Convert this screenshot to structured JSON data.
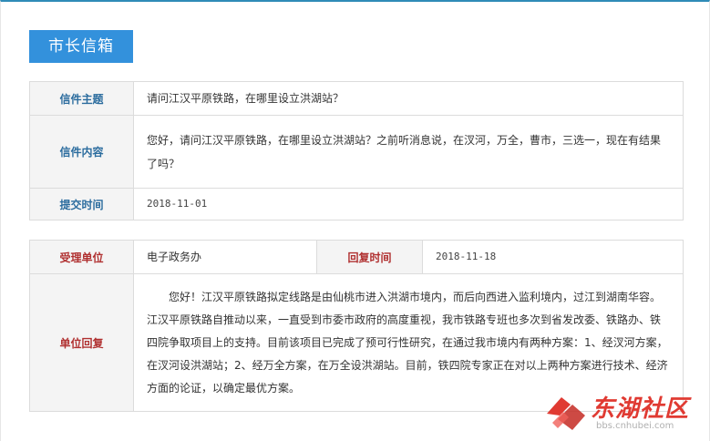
{
  "page": {
    "title_tab": "市长信箱"
  },
  "letter": {
    "subject_label": "信件主题",
    "subject_value": "请问江汉平原铁路，在哪里设立洪湖站？",
    "content_label": "信件内容",
    "content_value": "您好，请问江汉平原铁路，在哪里设立洪湖站？之前听消息说，在汊河，万全，曹市，三选一，现在有结果了吗？",
    "submit_time_label": "提交时间",
    "submit_time_value": "2018-11-01"
  },
  "reply": {
    "dept_label": "受理单位",
    "dept_value": "电子政务办",
    "reply_time_label": "回复时间",
    "reply_time_value": "2018-11-18",
    "answer_label": "单位回复",
    "answer_value": "您好！江汉平原铁路拟定线路是由仙桃市进入洪湖市境内，而后向西进入监利境内，过江到湖南华容。江汉平原铁路自推动以来，一直受到市委市政府的高度重视，我市铁路专班也多次到省发改委、铁路办、铁四院争取项目上的支持。目前该项目已完成了预可行性研究，在通过我市境内有两种方案：1、经汊河方案，在汊河设洪湖站；2、经万全方案，在万全设洪湖站。目前，铁四院专家正在对以上两种方案进行技术、经济方面的论证，以确定最优方案。"
  },
  "watermark": {
    "logo_icon": "donghu-logo-icon",
    "name": "东湖社区",
    "url": "bbs.cnhubei.com",
    "color": "#e03a32"
  },
  "colors": {
    "accent": "#3391dc",
    "top_border": "#2f8bb7",
    "label_blue": "#2b6c9e",
    "label_red": "#b03030"
  }
}
